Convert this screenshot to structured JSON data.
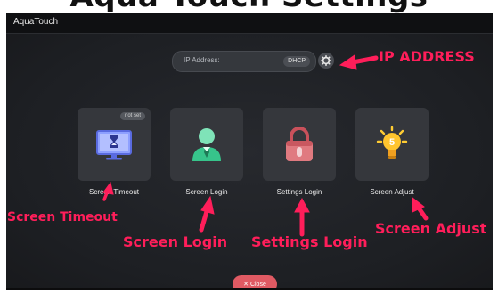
{
  "banner": {
    "text": "Aqua Touch Settings"
  },
  "app": {
    "title": "AquaTouch"
  },
  "ip": {
    "label": "IP Address:",
    "mode": "DHCP"
  },
  "tiles": [
    {
      "label": "Screen Timeout",
      "badge": "not set"
    },
    {
      "label": "Screen Login"
    },
    {
      "label": "Settings Login"
    },
    {
      "label": "Screen Adjust"
    }
  ],
  "close": {
    "label": "✕ Close"
  },
  "annotations": {
    "ip_address": "IP ADDRESS",
    "screen_timeout": "Screen Timeout",
    "screen_login": "Screen Login",
    "settings_login": "Settings Login",
    "screen_adjust": "Screen Adjust"
  },
  "colors": {
    "annotation": "#ff1e5a",
    "close": "#e05a63",
    "tile": "#35373c",
    "background": "#1d1f23"
  }
}
